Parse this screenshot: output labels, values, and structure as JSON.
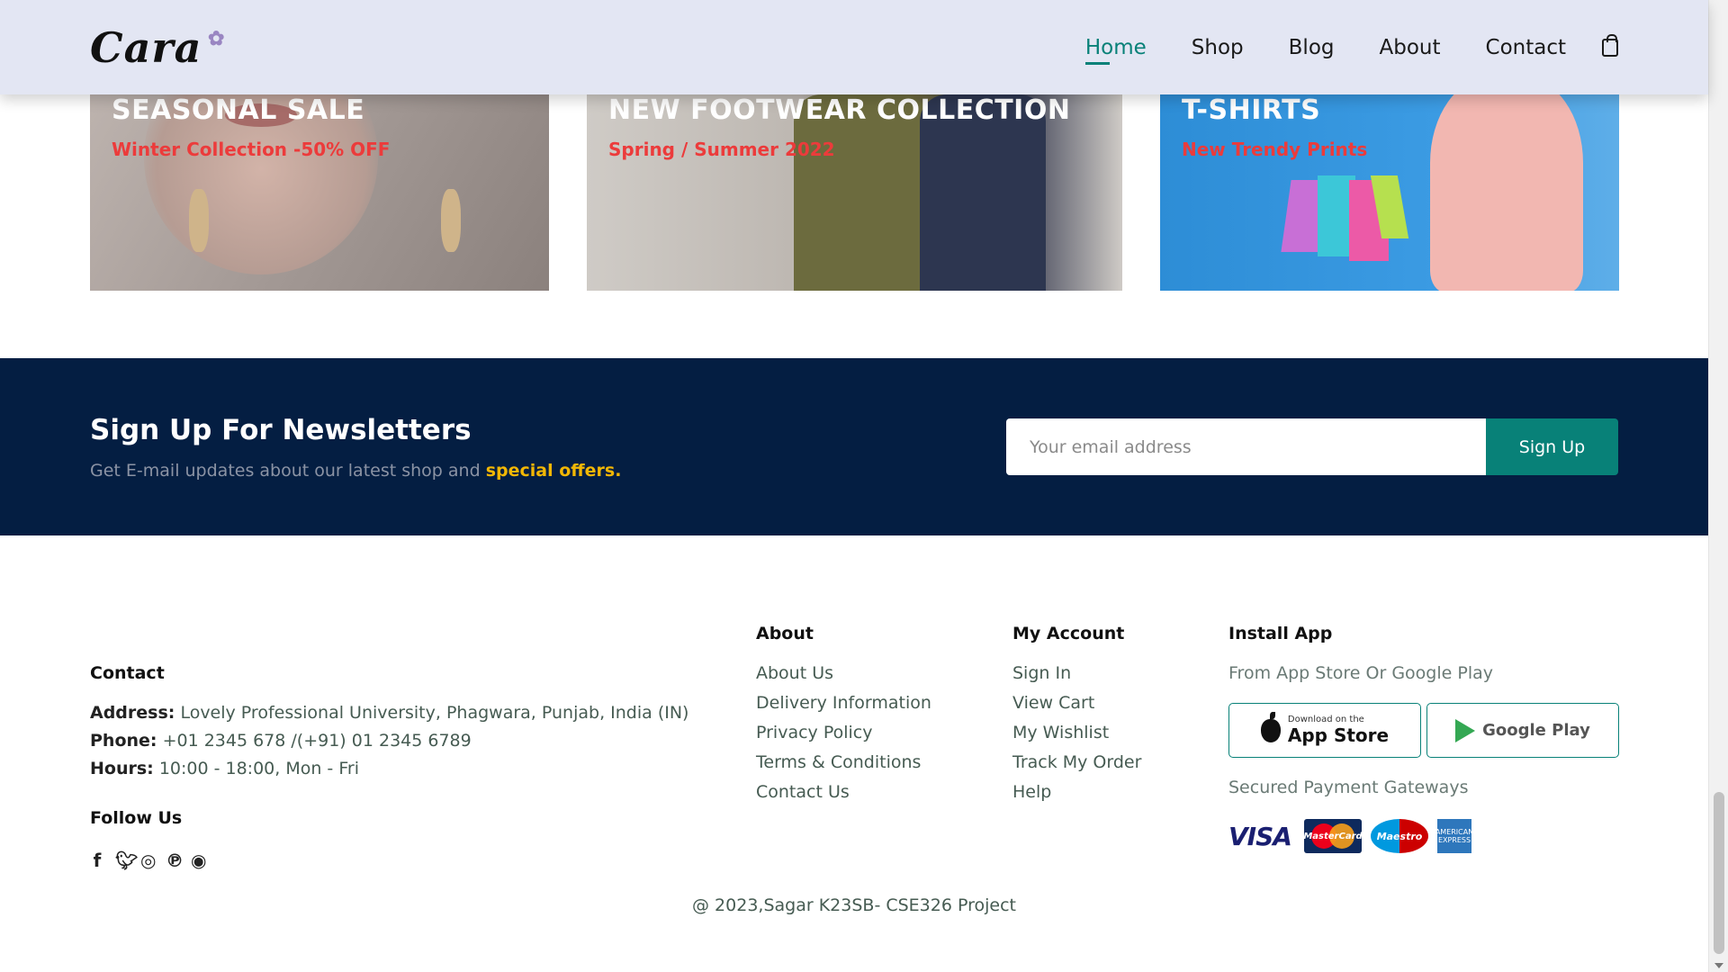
{
  "header": {
    "logo": "Cara",
    "nav": [
      "Home",
      "Shop",
      "Blog",
      "About",
      "Contact"
    ],
    "active": "Home",
    "cart_icon": "shopping-bag-icon"
  },
  "banners": [
    {
      "title": "SEASONAL SALE",
      "subtitle": "Winter Collection -50% OFF"
    },
    {
      "title": "NEW FOOTWEAR COLLECTION",
      "subtitle": "Spring / Summer 2022"
    },
    {
      "title": "T-SHIRTS",
      "subtitle": "New Trendy Prints"
    }
  ],
  "newsletter": {
    "title": "Sign Up For Newsletters",
    "text": "Get E-mail updates about our latest shop and",
    "highlight": "special offers.",
    "placeholder": "Your email address",
    "button": "Sign Up"
  },
  "footer": {
    "contact": {
      "heading": "Contact",
      "address_label": "Address:",
      "address": "Lovely Professional University, Phagwara, Punjab, India (IN)",
      "phone_label": "Phone:",
      "phone": "+01 2345 678 /(+91) 01 2345 6789",
      "hours_label": "Hours:",
      "hours": "10:00 - 18:00, Mon - Fri",
      "follow": "Follow Us",
      "social_icons": [
        "facebook-icon",
        "twitter-icon",
        "instagram-icon",
        "pinterest-icon",
        "github-icon"
      ]
    },
    "about": {
      "heading": "About",
      "links": [
        "About Us",
        "Delivery Information",
        "Privacy Policy",
        "Terms & Conditions",
        "Contact Us"
      ]
    },
    "account": {
      "heading": "My Account",
      "links": [
        "Sign In",
        "View Cart",
        "My Wishlist",
        "Track My Order",
        "Help"
      ]
    },
    "install": {
      "heading": "Install App",
      "sub": "From App Store Or Google Play",
      "appstore_small": "Download on the",
      "appstore": "App Store",
      "googleplay": "Google Play",
      "payments_heading": "Secured Payment Gateways",
      "payments": [
        "VISA",
        "MasterCard",
        "Maestro",
        "AMERICAN EXPRESS"
      ]
    },
    "copyright": "@ 2023,Sagar K23SB- CSE326 Project"
  },
  "colors": {
    "header_bg": "#e3e6f3",
    "accent": "#088178",
    "newsletter_bg": "#041e42",
    "highlight": "#f2b705",
    "banner_subtitle": "#ec3b3b"
  }
}
